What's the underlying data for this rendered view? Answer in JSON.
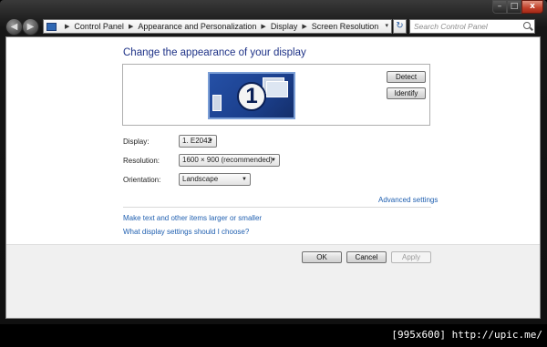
{
  "window_controls": {
    "minimize": "–",
    "maximize": "□",
    "close": "x"
  },
  "nav": {
    "back": "◀",
    "forward": "▶",
    "recent": "▾"
  },
  "breadcrumb": {
    "separator": "▶",
    "items": [
      "Control Panel",
      "Appearance and Personalization",
      "Display",
      "Screen Resolution"
    ],
    "dropdown": "▾"
  },
  "refresh": "↻",
  "search": {
    "placeholder": "Search Control Panel"
  },
  "main": {
    "heading": "Change the appearance of your display",
    "monitor_number": "1",
    "detect_label": "Detect",
    "identify_label": "Identify",
    "display": {
      "label": "Display:",
      "value": "1. E2042"
    },
    "resolution": {
      "label": "Resolution:",
      "value": "1600 × 900 (recommended)"
    },
    "orientation": {
      "label": "Orientation:",
      "value": "Landscape"
    },
    "combo_arrow": "▼",
    "advanced_link": "Advanced settings",
    "link_text_size": "Make text and other items larger or smaller",
    "link_help": "What display settings should I choose?"
  },
  "footer": {
    "ok": "OK",
    "cancel": "Cancel",
    "apply": "Apply"
  },
  "watermark": "[995x600] http://upic.me/"
}
